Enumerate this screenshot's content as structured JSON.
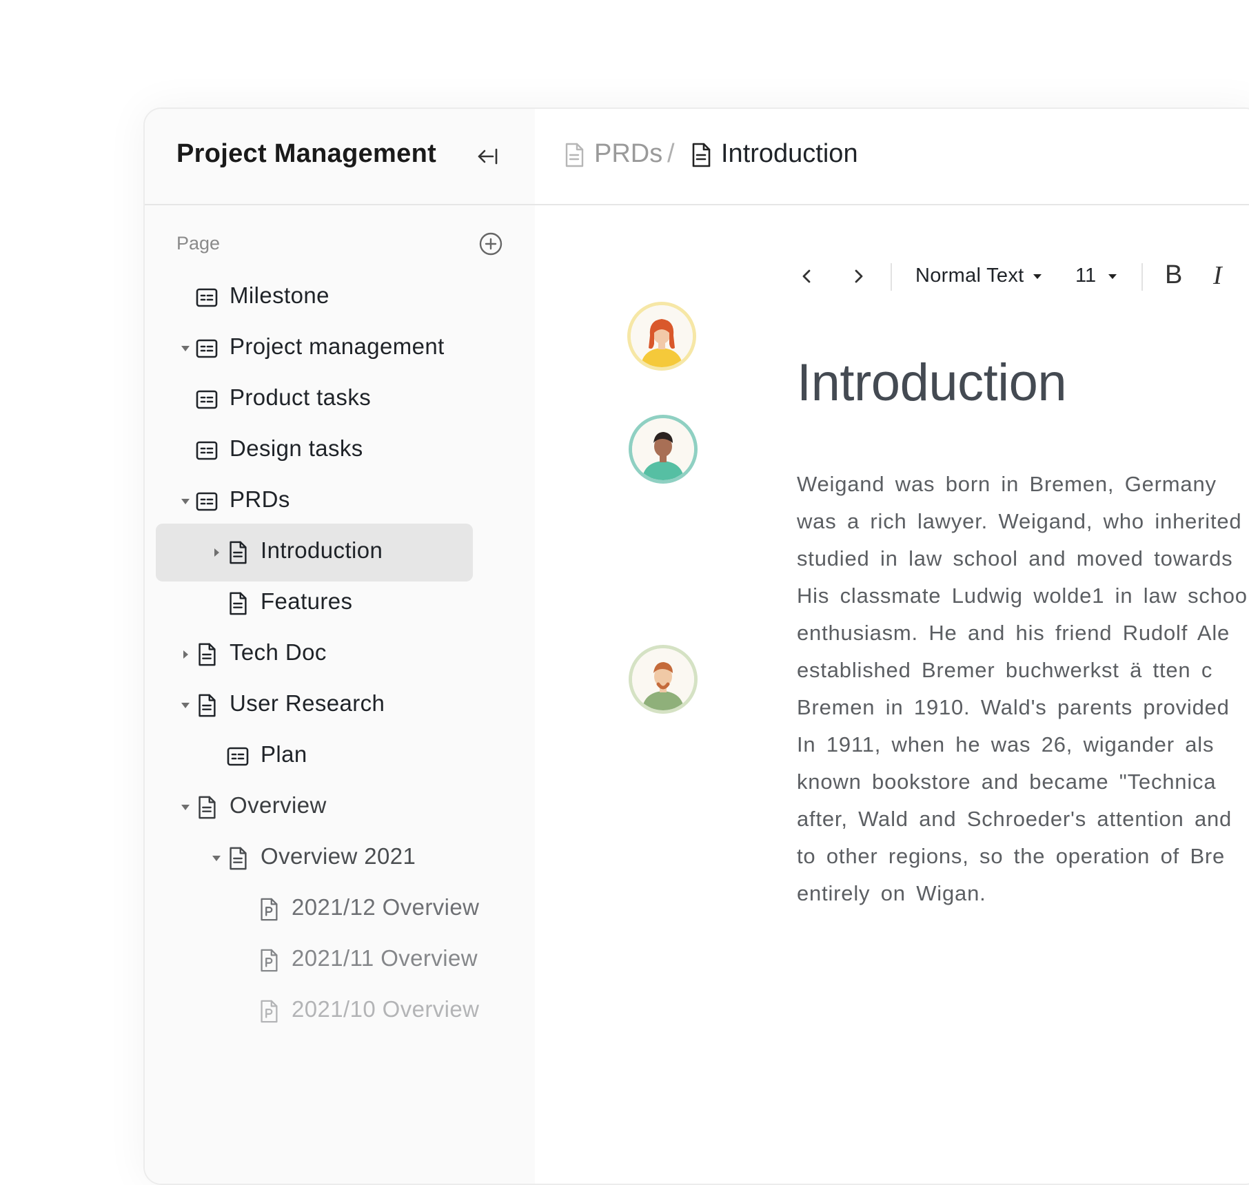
{
  "sidebar": {
    "title": "Project Management",
    "section_label": "Page",
    "items": [
      {
        "label": "Milestone",
        "icon": "table-icon",
        "caret": "none",
        "color": "#1f2328"
      },
      {
        "label": "Project management",
        "icon": "table-icon",
        "caret": "down",
        "color": "#1f2328"
      },
      {
        "label": "Product tasks",
        "icon": "table-icon",
        "caret": "none",
        "color": "#1f2328"
      },
      {
        "label": "Design tasks",
        "icon": "table-icon",
        "caret": "none",
        "color": "#1f2328"
      },
      {
        "label": "PRDs",
        "icon": "table-icon",
        "caret": "down",
        "color": "#1f2328"
      },
      {
        "label": "Introduction",
        "icon": "document-icon",
        "caret": "right",
        "color": "#1f2328",
        "selected": true
      },
      {
        "label": "Features",
        "icon": "document-icon",
        "caret": "none",
        "color": "#1f2328"
      },
      {
        "label": "Tech Doc",
        "icon": "document-icon",
        "caret": "right",
        "color": "#1f2328"
      },
      {
        "label": "User Research",
        "icon": "document-icon",
        "caret": "down",
        "color": "#1f2328"
      },
      {
        "label": "Plan",
        "icon": "table-icon",
        "caret": "none",
        "color": "#1f2328"
      },
      {
        "label": "Overview",
        "icon": "document-icon",
        "caret": "down",
        "color": "#3a3d40"
      },
      {
        "label": "Overview 2021",
        "icon": "document-icon",
        "caret": "down",
        "color": "#4a4d50"
      },
      {
        "label": "2021/12 Overview",
        "icon": "pdf-icon",
        "caret": "none",
        "color": "#6e7074"
      },
      {
        "label": "2021/11 Overview",
        "icon": "pdf-icon",
        "caret": "none",
        "color": "#85878a"
      },
      {
        "label": "2021/10 Overview",
        "icon": "pdf-icon",
        "caret": "none",
        "color": "#b3b4b6"
      }
    ]
  },
  "breadcrumb": {
    "parent": "PRDs",
    "separator": "/",
    "current": "Introduction"
  },
  "toolbar": {
    "text_style": "Normal Text",
    "font_size": "11",
    "bold_label": "B",
    "italic_label": "I"
  },
  "document": {
    "title": "Introduction",
    "lines": [
      "Weigand was born in Bremen, Germany",
      "was a rich lawyer. Weigand, who inherited",
      "studied in law school and moved towards",
      "His classmate Ludwig wolde1 in law schoo",
      "enthusiasm. He and his friend Rudolf Ale",
      "established Bremer buchwerkst ä tten c",
      "Bremen in 1910. Wald's parents provided",
      "In 1911, when he was 26, wigander als",
      "known bookstore and became \"Technica",
      "after, Wald and Schroeder's attention and",
      "to other regions, so the operation of Bre",
      "entirely on Wigan."
    ]
  },
  "avatars": [
    {
      "name": "avatar-woman-red-hair",
      "ring": "#f6e7a6",
      "skin": "#f2c9a8",
      "hair": "#d9582b",
      "shirt": "#f5c93a"
    },
    {
      "name": "avatar-man-dark-hair",
      "ring": "#8fd0c2",
      "skin": "#a86f55",
      "hair": "#2b2220",
      "shirt": "#56bfa3"
    },
    {
      "name": "avatar-man-beard",
      "ring": "#d5e2c4",
      "skin": "#f0c9a6",
      "hair": "#c46a3a",
      "shirt": "#8fb07a"
    }
  ]
}
